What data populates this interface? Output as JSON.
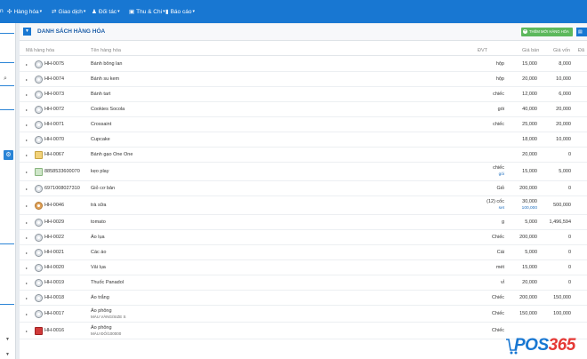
{
  "nav": [
    {
      "label": "n",
      "icon": ""
    },
    {
      "label": "Hàng hóa",
      "icon": "✣"
    },
    {
      "label": "Giao dịch",
      "icon": "⇄"
    },
    {
      "label": "Đối tác",
      "icon": "♟"
    },
    {
      "label": "Thu & Chi",
      "icon": "▣"
    },
    {
      "label": "Báo cáo",
      "icon": "▮"
    }
  ],
  "panel": {
    "title": "DANH SÁCH HÀNG HÓA",
    "add_button": "THÊM MỚI HÀNG HÓA"
  },
  "columns": [
    "Mã hàng hóa",
    "Tên hàng hóa",
    "ĐVT",
    "Giá bán",
    "Giá vốn",
    "Đã"
  ],
  "rows": [
    {
      "code": "HH-0075",
      "name": "Bánh bông lan",
      "sub": "",
      "unit": "hộp",
      "price": "15,000",
      "cost": "8,000",
      "thumb": "disk"
    },
    {
      "code": "HH-0074",
      "name": "Bánh su kem",
      "sub": "",
      "unit": "hộp",
      "price": "20,000",
      "cost": "10,000",
      "thumb": "disk"
    },
    {
      "code": "HH-0073",
      "name": "Bánh tart",
      "sub": "",
      "unit": "chiếc",
      "price": "12,000",
      "cost": "6,000",
      "thumb": "disk"
    },
    {
      "code": "HH-0072",
      "name": "Cookies Socola",
      "sub": "",
      "unit": "gói",
      "price": "40,000",
      "cost": "20,000",
      "thumb": "disk"
    },
    {
      "code": "HH-0071",
      "name": "Crossaint",
      "sub": "",
      "unit": "chiếc",
      "price": "25,000",
      "cost": "20,000",
      "thumb": "disk"
    },
    {
      "code": "HH-0070",
      "name": "Cupcake",
      "sub": "",
      "unit": "",
      "price": "18,000",
      "cost": "10,000",
      "thumb": "disk"
    },
    {
      "code": "HH-0067",
      "name": "Bánh gạo One One",
      "sub": "",
      "unit": "",
      "price": "20,000",
      "cost": "0",
      "thumb": "cup"
    },
    {
      "code": "8858533600070",
      "name": "kẹo play",
      "sub": "",
      "unit": "chiếc",
      "unit2": "gói",
      "price": "15,000",
      "cost": "5,000",
      "thumb": "blue"
    },
    {
      "code": "6971008027310",
      "name": "Giỏ cơ bản",
      "sub": "",
      "unit": "Giỏ",
      "price": "200,000",
      "cost": "0",
      "thumb": "disk"
    },
    {
      "code": "HH-0046",
      "name": "trà sữa",
      "sub": "",
      "unit": "(12) cốc",
      "unit2": "set",
      "price": "30,000",
      "price2": "100,000",
      "cost": "500,000",
      "thumb": "food"
    },
    {
      "code": "HH-0029",
      "name": "tomato",
      "sub": "",
      "unit": "g",
      "price": "5,000",
      "cost": "1,496,594",
      "thumb": "disk"
    },
    {
      "code": "HH-0022",
      "name": "Áo lụa",
      "sub": "",
      "unit": "Chiếc",
      "price": "200,000",
      "cost": "0",
      "thumb": "disk"
    },
    {
      "code": "HH-0021",
      "name": "Các áo",
      "sub": "",
      "unit": "Cái",
      "price": "5,000",
      "cost": "0",
      "thumb": "disk"
    },
    {
      "code": "HH-0020",
      "name": "Vải lụa",
      "sub": "",
      "unit": "mét",
      "price": "15,000",
      "cost": "0",
      "thumb": "disk"
    },
    {
      "code": "HH-0019",
      "name": "Thuốc Panadol",
      "sub": "",
      "unit": "vỉ",
      "price": "20,000",
      "cost": "0",
      "thumb": "disk"
    },
    {
      "code": "HH-0018",
      "name": "Áo trắng",
      "sub": "",
      "unit": "Chiếc",
      "price": "200,000",
      "cost": "150,000",
      "thumb": "disk"
    },
    {
      "code": "HH-0017",
      "name": "Áo phông",
      "sub": "MÀU VÀNG/SIZE S",
      "unit": "Chiếc",
      "price": "150,000",
      "cost": "100,000",
      "thumb": "disk"
    },
    {
      "code": "HH-0016",
      "name": "Áo phông",
      "sub": "MÀU ĐỎ/100000",
      "unit": "Chiếc",
      "price": "",
      "cost": "",
      "thumb": "red"
    }
  ],
  "logo": {
    "pos": "POS",
    "num": "365"
  }
}
